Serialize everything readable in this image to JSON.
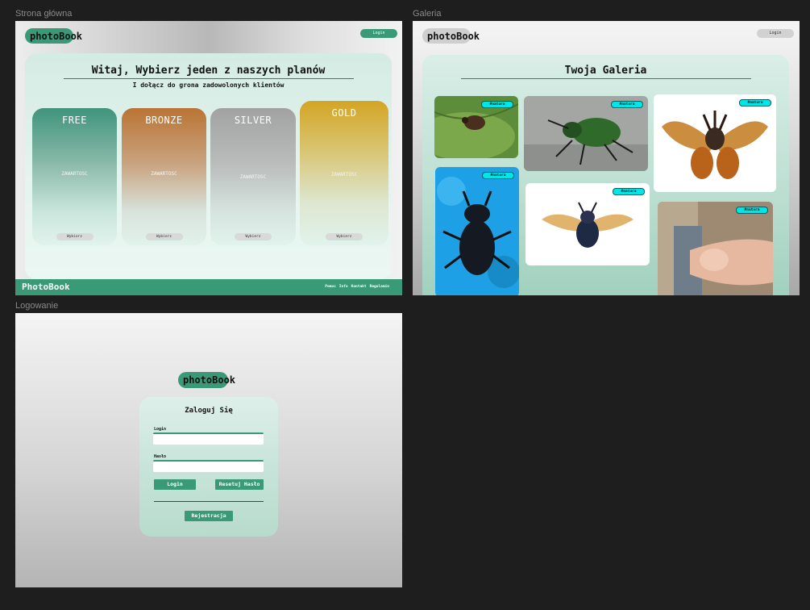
{
  "frames": {
    "main": "Strona główna",
    "gallery": "Galeria",
    "login": "Logowanie"
  },
  "logo": {
    "part1": "photoBo",
    "part2": "ok"
  },
  "header": {
    "login_label": "Login"
  },
  "home": {
    "title": "Witaj, Wybierz jeden z naszych planów",
    "subtitle": "I dołącz do grona zadowolonych klientów",
    "plans": [
      {
        "name": "FREE",
        "content": "ZAWARTOSC",
        "button": "Wybierz",
        "color_top": "#3f947b",
        "color_bottom": "#e1f3ec"
      },
      {
        "name": "BRONZE",
        "content": "ZAWARTOSC",
        "button": "Wybierz",
        "color_top": "#ba7434",
        "color_bottom": "#e1f3ec"
      },
      {
        "name": "SILVER",
        "content": "ZAWARTOSC",
        "button": "Wybierz",
        "color_top": "#a2a2a2",
        "color_bottom": "#e1f3ec"
      },
      {
        "name": "GOLD",
        "content": "ZAWARTOSC",
        "button": "Wybierz",
        "color_top": "#d3a524",
        "color_bottom": "#e1f3ec"
      }
    ]
  },
  "footer": {
    "brand": "PhotoBook",
    "links": [
      "Pomoc",
      "Info",
      "Kontakt",
      "Regulamin"
    ]
  },
  "gallery": {
    "title": "Twoja Galeria",
    "photos": [
      {
        "tag": "#natura",
        "subject": "beetle-on-leaf"
      },
      {
        "tag": "#natura",
        "subject": "green-beetle"
      },
      {
        "tag": "#natura",
        "subject": "rhinoceros-beetle-flying"
      },
      {
        "tag": "#natura",
        "subject": "stag-beetle-on-blue"
      },
      {
        "tag": "#natura",
        "subject": "flying-beetle-dark"
      },
      {
        "tag": "#natura",
        "subject": "finger-outdoor"
      }
    ]
  },
  "login": {
    "heading": "Zaloguj Się",
    "login_label": "Login",
    "password_label": "Hasło",
    "login_button": "Login",
    "reset_button": "Resetuj Hasło",
    "register_button": "Rejestracja",
    "login_value": "",
    "password_value": ""
  },
  "colors": {
    "accent": "#3a9a78",
    "tag": "#00e5e5"
  }
}
